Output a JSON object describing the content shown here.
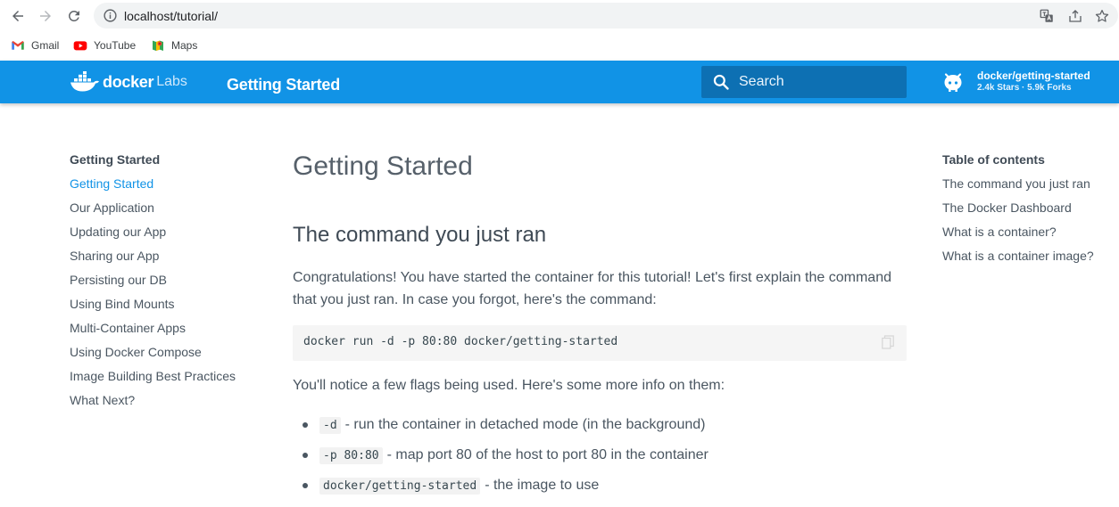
{
  "browser": {
    "url": "localhost/tutorial/",
    "bookmarks": [
      {
        "label": "Gmail",
        "icon": "gmail-icon"
      },
      {
        "label": "YouTube",
        "icon": "youtube-icon"
      },
      {
        "label": "Maps",
        "icon": "maps-icon"
      }
    ]
  },
  "header": {
    "logo_word": "docker",
    "logo_suffix": "Labs",
    "title": "Getting Started",
    "search_placeholder": "Search",
    "repo_name": "docker/getting-started",
    "repo_facts": "2.4k Stars · 5.9k Forks",
    "accent_color": "#1193e6"
  },
  "left_nav": {
    "title": "Getting Started",
    "items": [
      {
        "label": "Getting Started",
        "active": true
      },
      {
        "label": "Our Application"
      },
      {
        "label": "Updating our App"
      },
      {
        "label": "Sharing our App"
      },
      {
        "label": "Persisting our DB"
      },
      {
        "label": "Using Bind Mounts"
      },
      {
        "label": "Multi-Container Apps"
      },
      {
        "label": "Using Docker Compose"
      },
      {
        "label": "Image Building Best Practices"
      },
      {
        "label": "What Next?"
      }
    ]
  },
  "toc": {
    "title": "Table of contents",
    "items": [
      "The command you just ran",
      "The Docker Dashboard",
      "What is a container?",
      "What is a container image?"
    ]
  },
  "main": {
    "h1": "Getting Started",
    "h2": "The command you just ran",
    "para1": "Congratulations! You have started the container for this tutorial! Let's first explain the command that you just ran. In case you forgot, here's the command:",
    "code": "docker run -d -p 80:80 docker/getting-started",
    "para2": "You'll notice a few flags being used. Here's some more info on them:",
    "bullets": [
      {
        "code": "-d",
        "text": "- run the container in detached mode (in the background)"
      },
      {
        "code": "-p 80:80",
        "text": "- map port 80 of the host to port 80 in the container"
      },
      {
        "code": "docker/getting-started",
        "text": "- the image to use"
      }
    ]
  }
}
